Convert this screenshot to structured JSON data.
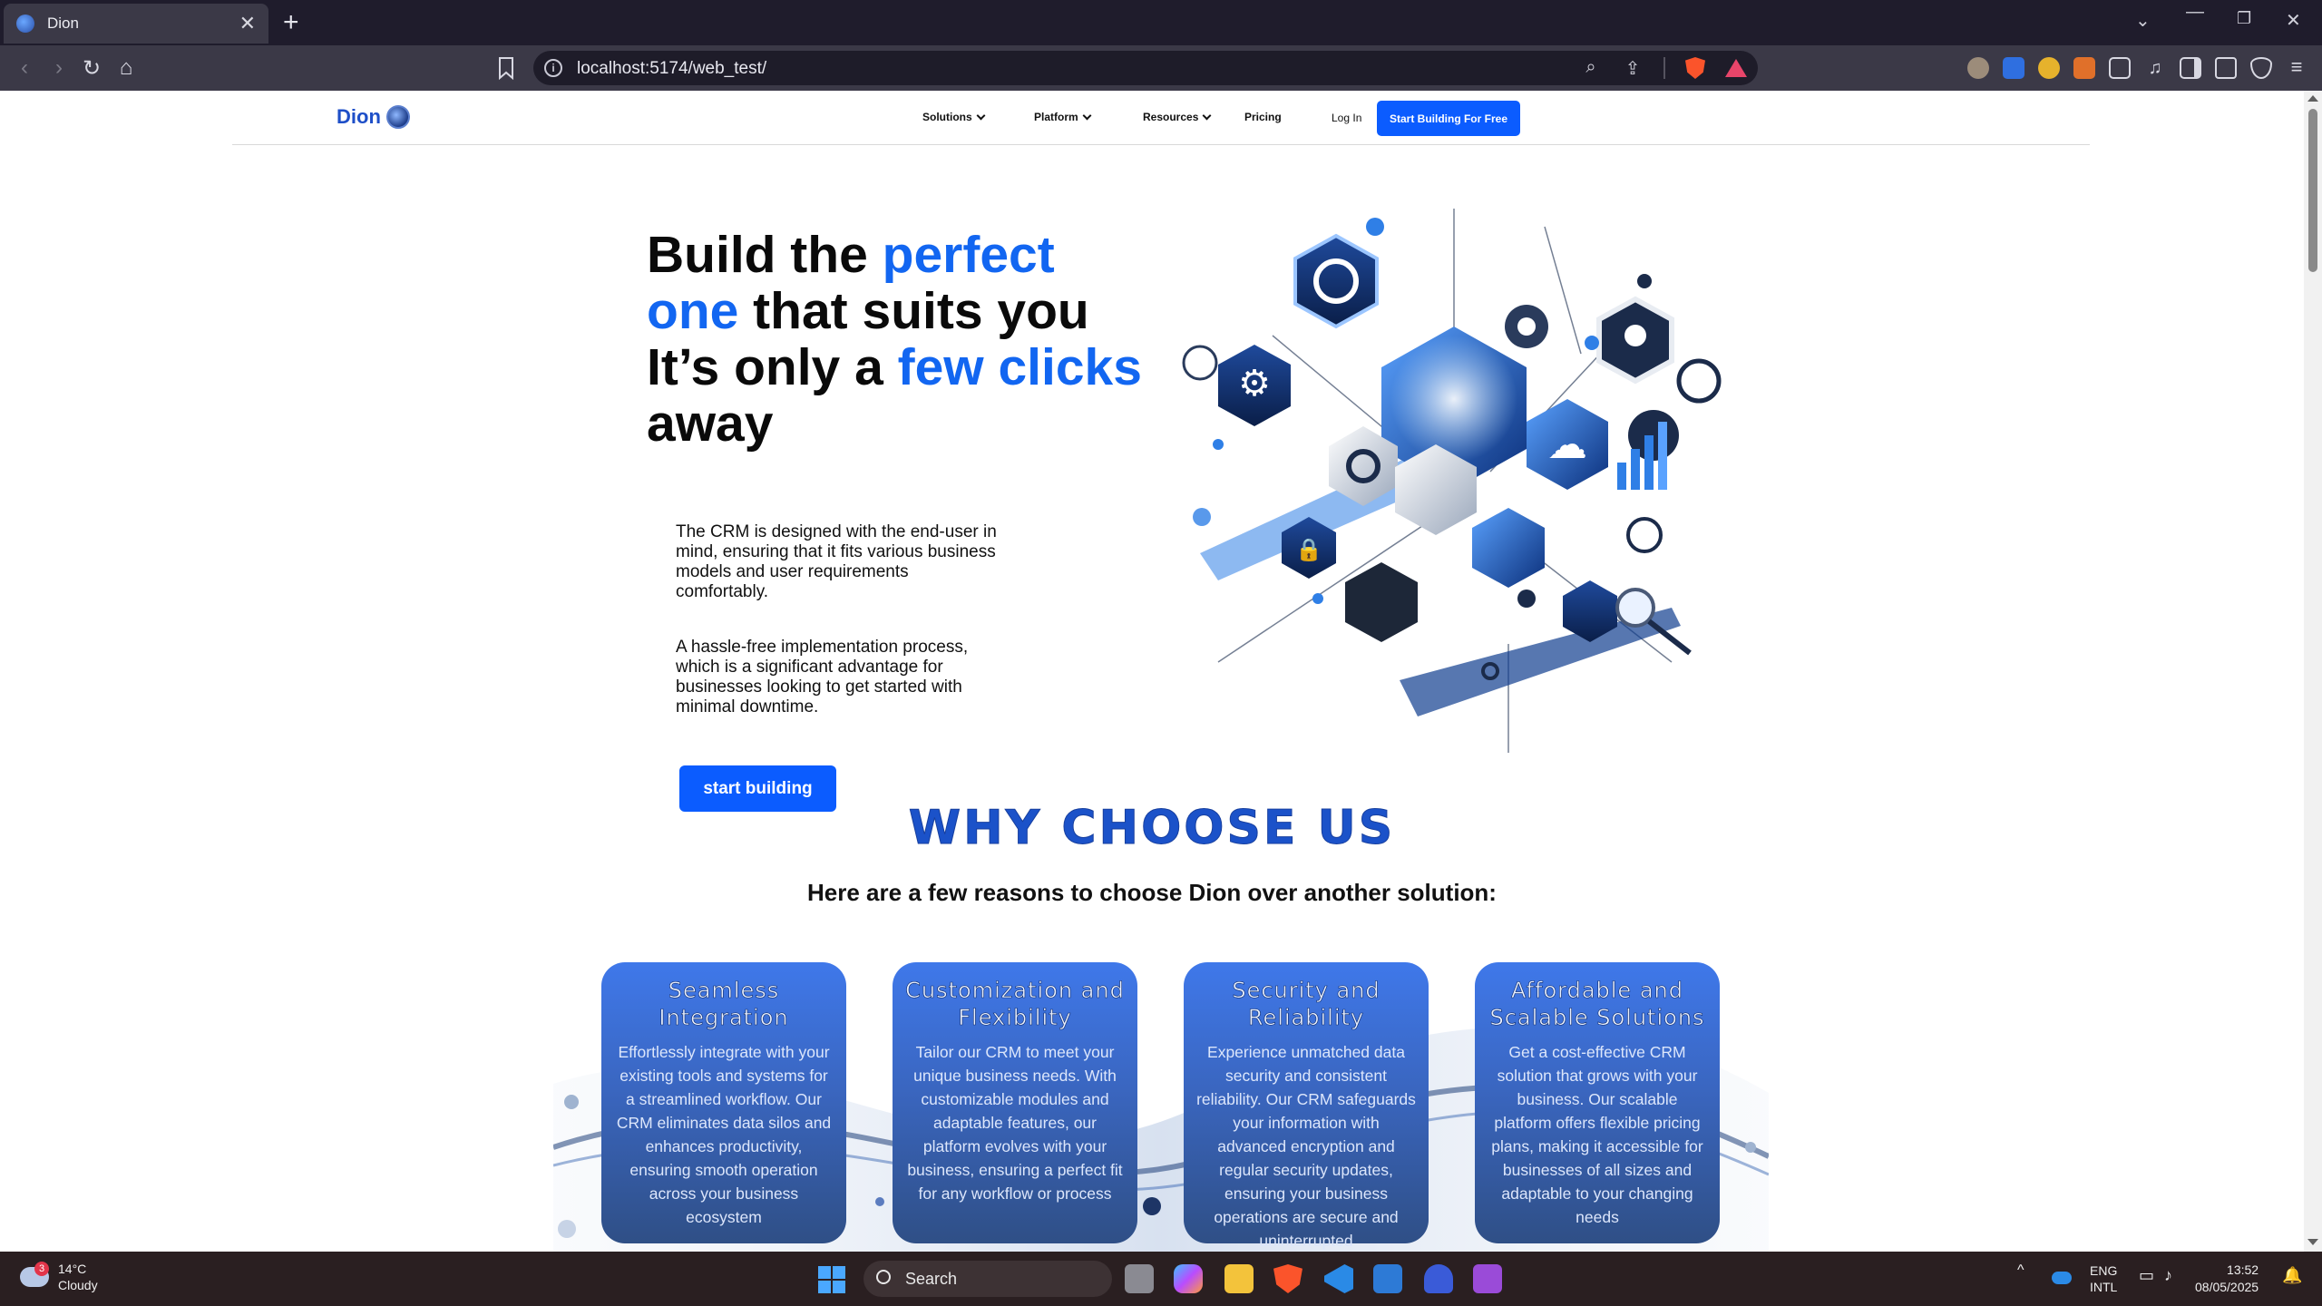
{
  "browser": {
    "tab_title": "Dion",
    "tab_close": "✕",
    "new_tab": "+",
    "url": "localhost:5174/web_test/",
    "info_glyph": "i"
  },
  "site": {
    "logo_text": "Dion",
    "nav": {
      "solutions": "Solutions",
      "platform": "Platform",
      "resources": "Resources",
      "pricing": "Pricing",
      "login": "Log In",
      "cta": "Start Building For Free"
    },
    "hero": {
      "title_1": "Build the ",
      "title_hl_1": "perfect one",
      "title_2": " that suits you It’s only a ",
      "title_hl_2": "few clicks",
      "title_3": " away",
      "para_1": "The CRM is designed with the end-user in mind, ensuring that it fits various business models and user requirements comfortably.",
      "para_2": "A hassle-free implementation process, which is a significant advantage for businesses looking to get started with minimal downtime.",
      "button": "start building"
    },
    "why": {
      "title": "WHY CHOOSE US",
      "subtitle": "Here are a few reasons to choose Dion over another solution:"
    },
    "features": [
      {
        "title": "Seamless Integration",
        "body": "Effortlessly integrate with your existing tools and systems for a streamlined workflow. Our CRM eliminates data silos and enhances productivity, ensuring smooth operation across your business ecosystem"
      },
      {
        "title": "Customization and Flexibility",
        "body": "Tailor our CRM to meet your unique business needs. With customizable modules and adaptable features, our platform evolves with your business, ensuring a perfect fit for any workflow or process"
      },
      {
        "title": "Security and Reliability",
        "body": "Experience unmatched data security and consistent reliability. Our CRM safeguards your information with advanced encryption and regular security updates, ensuring your business operations are secure and uninterrupted"
      },
      {
        "title": "Affordable and Scalable Solutions",
        "body": "Get a cost-effective CRM solution that grows with your business. Our scalable platform offers flexible pricing plans, making it accessible for businesses of all sizes and adaptable to your changing needs"
      }
    ]
  },
  "taskbar": {
    "weather_temp": "14°C",
    "weather_desc": "Cloudy",
    "weather_badge": "3",
    "search_label": "Search",
    "lang_1": "ENG",
    "lang_2": "INTL",
    "time": "13:52",
    "date": "08/05/2025"
  },
  "colors": {
    "accent": "#0b5cff",
    "headline_highlight": "#1266f1",
    "why_title": "#1b52c9"
  }
}
